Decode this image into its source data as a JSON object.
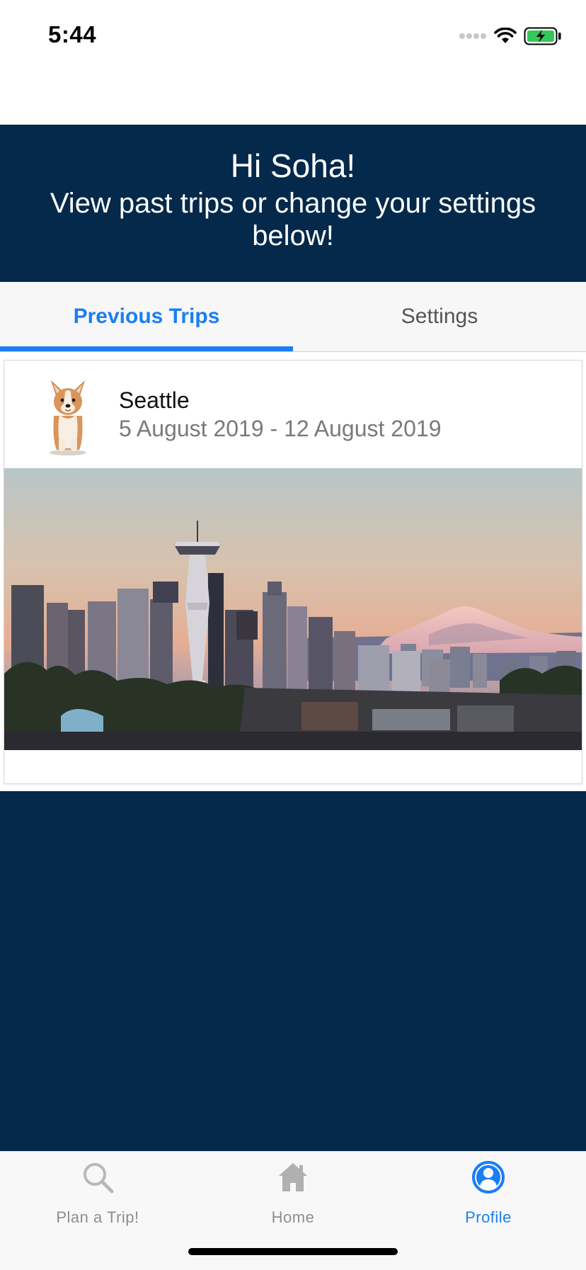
{
  "status_bar": {
    "time": "5:44",
    "icons": [
      "cellular-signal-icon",
      "wifi-icon",
      "battery-charging-icon"
    ],
    "battery_color": "#34c759"
  },
  "header": {
    "greeting": "Hi Soha!",
    "subtitle": "View past trips or change your settings below!"
  },
  "tabs": [
    {
      "label": "Previous Trips",
      "active": true
    },
    {
      "label": "Settings",
      "active": false
    }
  ],
  "trips": [
    {
      "city": "Seattle",
      "dates": "5 August 2019 - 12 August 2019",
      "avatar_icon": "corgi-avatar",
      "photo": "seattle-skyline-photo"
    }
  ],
  "tabbar": {
    "items": [
      {
        "label": "Plan a Trip!",
        "icon": "search-icon",
        "active": false
      },
      {
        "label": "Home",
        "icon": "home-icon",
        "active": false
      },
      {
        "label": "Profile",
        "icon": "profile-icon",
        "active": true
      }
    ]
  },
  "colors": {
    "navy": "#04294a",
    "accent": "#1a7ef5",
    "inactive": "#8e8e8e"
  }
}
